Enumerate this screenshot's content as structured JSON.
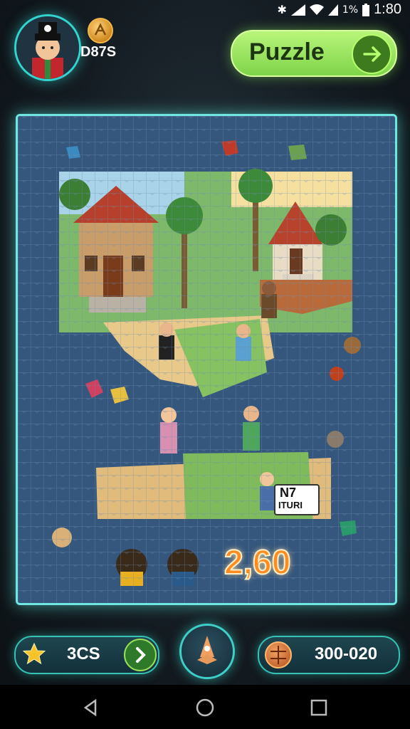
{
  "status_bar": {
    "time": "1:80",
    "battery": "1%"
  },
  "header": {
    "coin_value": "D87S",
    "puzzle_button_label": "Puzzle"
  },
  "board": {
    "counter_value": "2,60",
    "sign_line1": "N7",
    "sign_line2": "ITURI"
  },
  "footer": {
    "stars_value": "3CS",
    "coins_value": "300-020"
  },
  "colors": {
    "accent_cyan": "#33d4cf",
    "puzzle_green": "#8ee054",
    "counter_orange": "#ff8b1e"
  },
  "icons": [
    "bluetooth-icon",
    "signal-icon",
    "wifi-icon",
    "battery-icon",
    "coin-icon",
    "arrow-right-icon",
    "star-icon",
    "chevron-right-icon",
    "rocket-icon",
    "ball-icon",
    "back-icon",
    "home-icon",
    "recents-icon"
  ]
}
